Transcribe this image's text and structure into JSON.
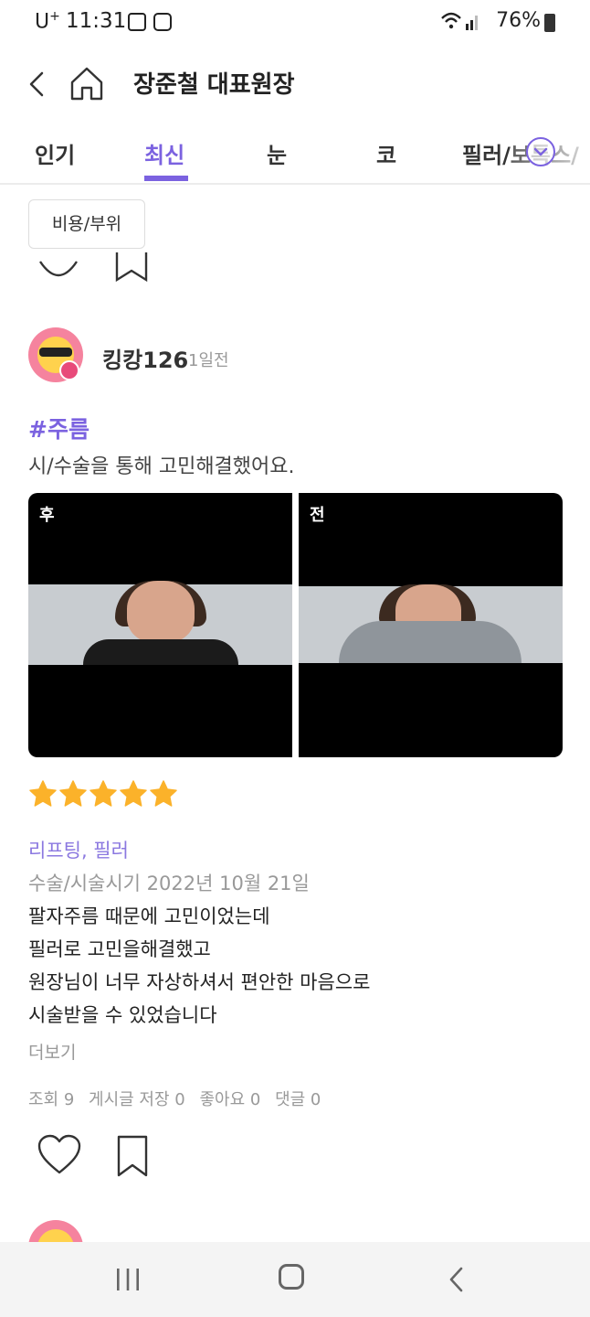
{
  "status_bar": {
    "carrier": "U",
    "carrier_sup": "+",
    "time": "11:31",
    "battery": "76%",
    "icons": [
      "gallery-icon",
      "record-icon",
      "wifi-icon",
      "signal-icon",
      "battery-icon"
    ]
  },
  "header": {
    "title": "장준철 대표원장",
    "back_icon": "chevron-left-icon",
    "home_icon": "home-icon"
  },
  "tabs": {
    "items": [
      "인기",
      "최신",
      "눈",
      "코",
      "필러/보톡스/"
    ],
    "active": "최신",
    "more_icon": "chevron-down-icon",
    "accent_color": "#7b62e0"
  },
  "filter": {
    "chip_label": "비용/부위"
  },
  "post": {
    "username": "킹캉126",
    "time_ago": "1일전",
    "hashtag": "#주름",
    "summary": "시/수술을 통해 고민해결했어요.",
    "photos": [
      {
        "label": "후"
      },
      {
        "label": "전"
      }
    ],
    "rating": 5,
    "star_color": "#fbb22a",
    "procedures": "리프팅, 필러",
    "surgery_date": "수술/시술시기 2022년 10월 21일",
    "body_lines": [
      "팔자주름 때문에 고민이었는데",
      "필러로 고민을해결했고",
      "원장님이 너무 자상하셔서 편안한 마음으로",
      "시술받을 수 있었습니다"
    ],
    "more": "더보기",
    "stats": {
      "views": "조회 9",
      "saves": "게시글 저장 0",
      "likes": "좋아요 0",
      "comments": "댓글 0"
    }
  },
  "navbar": {
    "icons": [
      "recents-icon",
      "home-circle-icon",
      "back-icon"
    ]
  }
}
